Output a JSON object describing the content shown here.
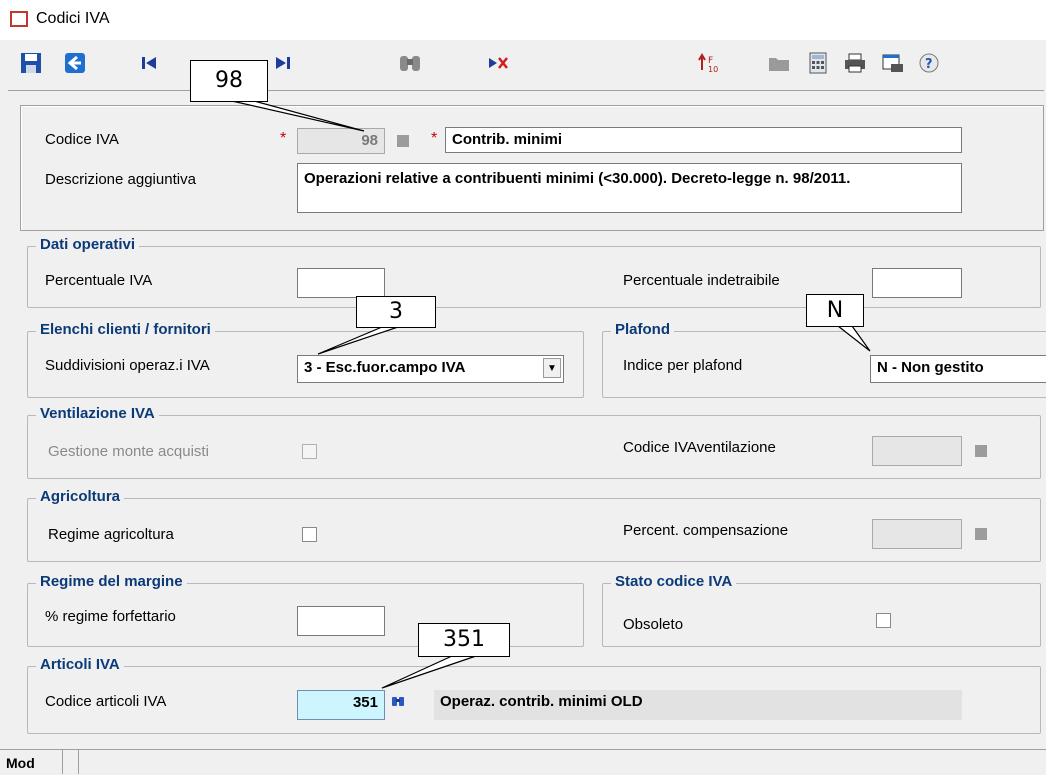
{
  "window": {
    "title": "Codici IVA"
  },
  "toolbar": {
    "icons": [
      "save-icon",
      "back-icon",
      "first-record-icon",
      "last-record-icon",
      "binoculars-search-icon",
      "delete-icon",
      "sort-icon",
      "folder-icon",
      "calculator-icon",
      "print-icon",
      "print-preview-icon",
      "help-icon"
    ]
  },
  "callouts": {
    "codice": "98",
    "suddivisione": "3",
    "plafond": "N",
    "articoli": "351"
  },
  "header": {
    "codice_iva_label": "Codice IVA",
    "codice_iva_value": "98",
    "star": "*",
    "description_value": "Contrib. minimi",
    "desc_agg_label": "Descrizione aggiuntiva",
    "desc_agg_value": "Operazioni relative a contribuenti minimi (<30.000). Decreto-legge n. 98/2011."
  },
  "dati_operativi": {
    "title": "Dati operativi",
    "perc_iva_label": "Percentuale IVA",
    "perc_iva_value": "",
    "perc_indetr_label": "Percentuale indetraibile",
    "perc_indetr_value": ""
  },
  "elenchi": {
    "title": "Elenchi clienti / fornitori",
    "suddiv_label": "Suddivisioni operaz.i IVA",
    "suddiv_value": "3  - Esc.fuor.campo IVA"
  },
  "plafond": {
    "title": "Plafond",
    "indice_label": "Indice per plafond",
    "indice_value": "N  - Non gestito"
  },
  "ventilazione": {
    "title": "Ventilazione IVA",
    "gestione_label": "Gestione monte acquisti",
    "codice_label": "Codice IVAventilazione",
    "codice_value": ""
  },
  "agricoltura": {
    "title": "Agricoltura",
    "regime_label": "Regime agricoltura",
    "compens_label": "Percent. compensazione",
    "compens_value": ""
  },
  "margine": {
    "title": "Regime del margine",
    "forfettario_label": "% regime forfettario",
    "forfettario_value": ""
  },
  "stato": {
    "title": "Stato codice IVA",
    "obsoleto_label": "Obsoleto"
  },
  "articoli": {
    "title": "Articoli IVA",
    "codice_label": "Codice articoli IVA",
    "codice_value": "351",
    "descr_value": "Operaz. contrib. minimi OLD"
  },
  "status": {
    "mode": "Mod"
  }
}
